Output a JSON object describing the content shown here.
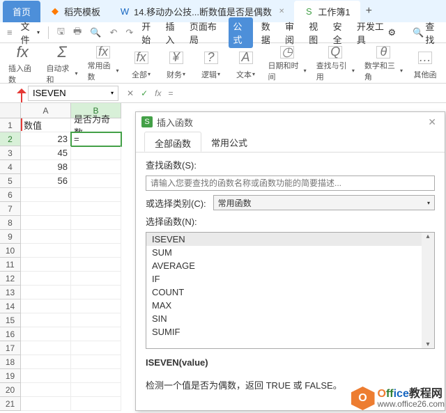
{
  "tabs": {
    "home": "首页",
    "docer": "稻壳模板",
    "file1": "14.移动办公技...断数值是否是偶数",
    "file2": "工作簿1"
  },
  "menu": {
    "fileMenu": "文件",
    "items": [
      "开始",
      "插入",
      "页面布局",
      "公式",
      "数据",
      "审阅",
      "视图",
      "安全",
      "开发工具"
    ],
    "search": "查找"
  },
  "tools": {
    "insertFn": "插入函数",
    "autoSum": "自动求和",
    "commonFn": "常用函数",
    "all": "全部",
    "finance": "财务",
    "logic": "逻辑",
    "text": "文本",
    "datetime": "日期和时间",
    "lookup": "查找与引用",
    "math": "数学和三角",
    "other": "其他函"
  },
  "formula_bar": {
    "name_box": "ISEVEN",
    "eq": "="
  },
  "grid": {
    "col_a": "A",
    "col_b": "B",
    "a1": "数值",
    "b1": "是否为奇数",
    "rows": [
      {
        "a": "23",
        "b": "="
      },
      {
        "a": "45",
        "b": ""
      },
      {
        "a": "98",
        "b": ""
      },
      {
        "a": "56",
        "b": ""
      }
    ]
  },
  "dialog": {
    "title": "插入函数",
    "tab_all": "全部函数",
    "tab_common": "常用公式",
    "search_label": "查找函数(S):",
    "search_placeholder": "请输入您要查找的函数名称或函数功能的简要描述...",
    "category_label": "或选择类别(C):",
    "category_value": "常用函数",
    "list_label": "选择函数(N):",
    "functions": [
      "ISEVEN",
      "SUM",
      "AVERAGE",
      "IF",
      "COUNT",
      "MAX",
      "SIN",
      "SUMIF"
    ],
    "syntax": "ISEVEN(value)",
    "description": "检测一个值是否为偶数，返回 TRUE 或 FALSE。"
  },
  "watermark": {
    "line1_office": "Office",
    "line1_zh": "教程网",
    "line2": "www.office26.com"
  }
}
